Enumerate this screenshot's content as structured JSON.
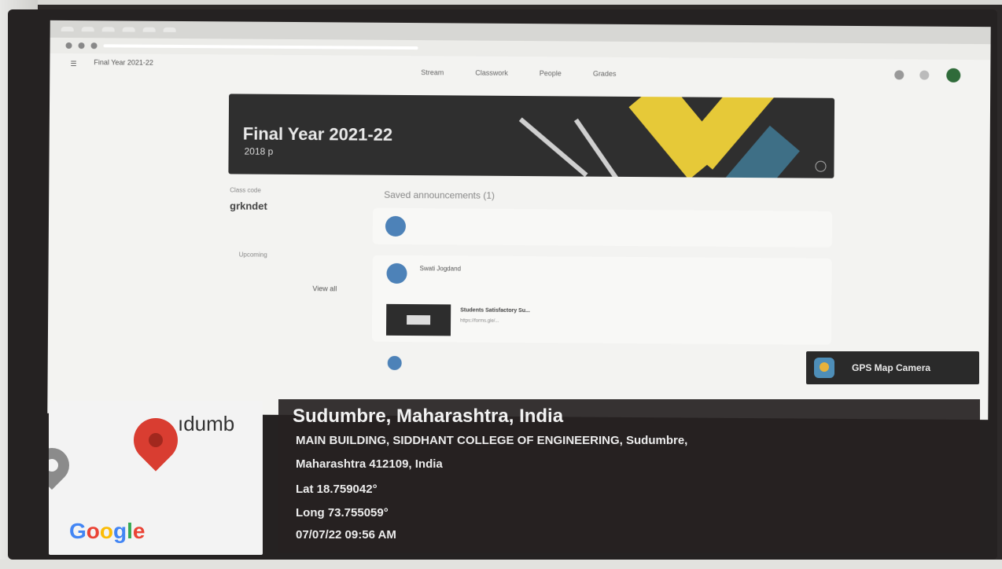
{
  "browser": {
    "tabs": [
      "",
      "",
      "",
      "",
      "",
      ""
    ],
    "url": ""
  },
  "classroom": {
    "app_title": "Final Year 2021-22",
    "nav_tabs": [
      "Stream",
      "Classwork",
      "People",
      "Grades"
    ],
    "banner_title": "Final Year 2021-22",
    "banner_subtitle": "2018 p",
    "class_code_label": "Class code",
    "class_code": "grkndet",
    "upcoming_label": "Upcoming",
    "upcoming_text": "",
    "view_all": "View all",
    "saved_announcements": "Saved announcements (1)",
    "post_author": "Swati Jogdand",
    "attachment_title": "Students Satisfactory Su...",
    "attachment_url": "https://forms.gle/..."
  },
  "gps_overlay": {
    "app_name": "GPS Map Camera",
    "city_line": "Sudumbre, Maharashtra, India",
    "address_line1": "MAIN BUILDING, SIDDHANT COLLEGE OF ENGINEERING, Sudumbre,",
    "address_line2": "Maharashtra 412109, India",
    "lat": "Lat 18.759042°",
    "long": "Long 73.755059°",
    "datetime": "07/07/22 09:56 AM",
    "map_label": "ıdumb",
    "map_brand": "Google"
  },
  "colors": {
    "gps_box": "#262222",
    "pin_red": "#d93d31",
    "banner_yellow": "#e6c938"
  }
}
